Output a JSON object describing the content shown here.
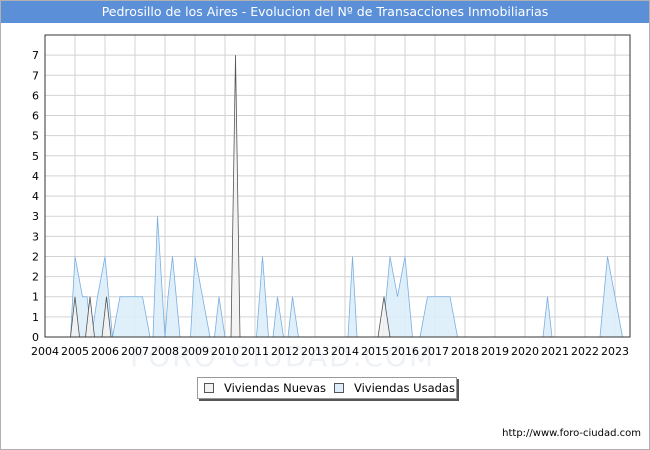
{
  "title": "Pedrosillo de los Aires - Evolucion del Nº de Transacciones Inmobiliarias",
  "watermark": "FORO-CIUDAD.COM",
  "footer": "http://www.foro-ciudad.com",
  "legend": {
    "nuevas": "Viviendas Nuevas",
    "usadas": "Viviendas Usadas"
  },
  "colors": {
    "title_bg": "#5b8fd7",
    "nuevas_fill": "#f2f2f2",
    "nuevas_line": "#555555",
    "usadas_fill": "#ddeefa",
    "usadas_line": "#7aaee0",
    "grid": "#d3d3d3"
  },
  "chart_data": {
    "type": "area",
    "x_tick_labels": [
      "2004",
      "2005",
      "2006",
      "2007",
      "2008",
      "2009",
      "2010",
      "2011",
      "2012",
      "2013",
      "2014",
      "2015",
      "2016",
      "2017",
      "2018",
      "2019",
      "2020",
      "2021",
      "2022",
      "2023"
    ],
    "y_tick_labels": [
      "0",
      "1",
      "1",
      "2",
      "2",
      "3",
      "3",
      "4",
      "4",
      "5",
      "5",
      "6",
      "6",
      "7",
      "7"
    ],
    "ylim": [
      0,
      7.5
    ],
    "grid": true,
    "legend_position": "bottom-center",
    "series": [
      {
        "name": "Viviendas Nuevas",
        "points": [
          [
            2004.0,
            0
          ],
          [
            2004.85,
            0
          ],
          [
            2005.0,
            1
          ],
          [
            2005.15,
            0
          ],
          [
            2005.35,
            0
          ],
          [
            2005.5,
            1
          ],
          [
            2005.65,
            0
          ],
          [
            2005.9,
            0
          ],
          [
            2006.05,
            1
          ],
          [
            2006.2,
            0
          ],
          [
            2010.2,
            0
          ],
          [
            2010.35,
            7
          ],
          [
            2010.5,
            0
          ],
          [
            2015.1,
            0
          ],
          [
            2015.3,
            1
          ],
          [
            2015.5,
            0
          ],
          [
            2023.5,
            0
          ]
        ]
      },
      {
        "name": "Viviendas Usadas",
        "points": [
          [
            2004.0,
            0
          ],
          [
            2004.85,
            0
          ],
          [
            2005.0,
            2
          ],
          [
            2005.25,
            1
          ],
          [
            2005.4,
            1
          ],
          [
            2005.55,
            0
          ],
          [
            2005.75,
            1
          ],
          [
            2006.0,
            2
          ],
          [
            2006.25,
            0
          ],
          [
            2006.5,
            1
          ],
          [
            2007.25,
            1
          ],
          [
            2007.5,
            0
          ],
          [
            2007.6,
            0
          ],
          [
            2007.75,
            3
          ],
          [
            2008.0,
            0
          ],
          [
            2008.1,
            1
          ],
          [
            2008.25,
            2
          ],
          [
            2008.5,
            0
          ],
          [
            2008.85,
            0
          ],
          [
            2009.0,
            2
          ],
          [
            2009.25,
            1
          ],
          [
            2009.5,
            0
          ],
          [
            2009.65,
            0
          ],
          [
            2009.8,
            1
          ],
          [
            2010.0,
            0
          ],
          [
            2011.05,
            0
          ],
          [
            2011.25,
            2
          ],
          [
            2011.45,
            0
          ],
          [
            2011.6,
            0
          ],
          [
            2011.75,
            1
          ],
          [
            2011.95,
            0
          ],
          [
            2012.1,
            0
          ],
          [
            2012.25,
            1
          ],
          [
            2012.45,
            0
          ],
          [
            2014.0,
            0
          ],
          [
            2014.1,
            0
          ],
          [
            2014.25,
            2
          ],
          [
            2014.4,
            0
          ],
          [
            2015.25,
            0
          ],
          [
            2015.5,
            2
          ],
          [
            2015.75,
            1
          ],
          [
            2016.0,
            2
          ],
          [
            2016.25,
            0
          ],
          [
            2016.5,
            0
          ],
          [
            2016.75,
            1
          ],
          [
            2017.5,
            1
          ],
          [
            2017.75,
            0
          ],
          [
            2020.6,
            0
          ],
          [
            2020.75,
            1
          ],
          [
            2020.9,
            0
          ],
          [
            2022.5,
            0
          ],
          [
            2022.75,
            2
          ],
          [
            2023.0,
            1
          ],
          [
            2023.25,
            0
          ],
          [
            2023.5,
            0
          ]
        ]
      }
    ]
  }
}
